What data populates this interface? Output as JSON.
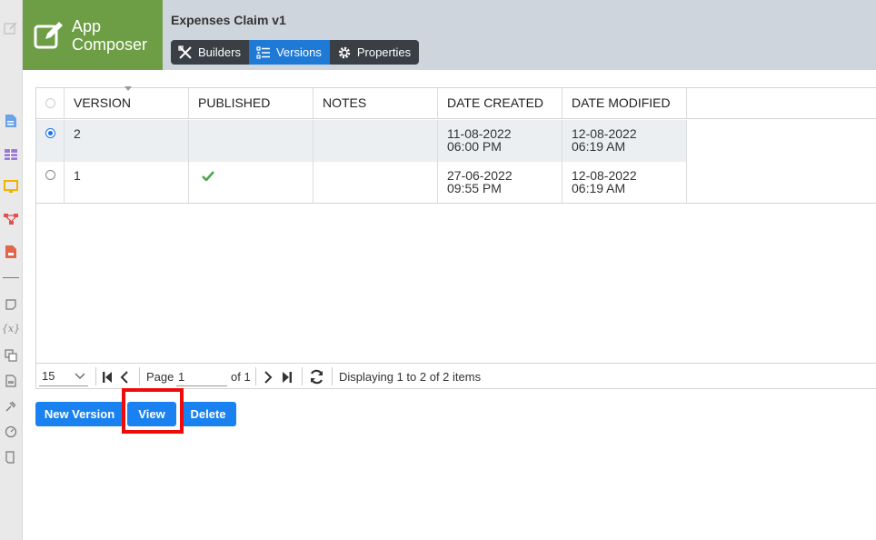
{
  "app": {
    "logo_line1": "App",
    "logo_line2": "Composer",
    "title": "Expenses Claim v1"
  },
  "tabs": [
    {
      "label": "Builders",
      "icon": "builders-icon",
      "active": false
    },
    {
      "label": "Versions",
      "icon": "list-icon",
      "active": true
    },
    {
      "label": "Properties",
      "icon": "gear-icon",
      "active": false
    }
  ],
  "rail_icons": [
    "edit-icon",
    "form-icon",
    "datalist-icon",
    "userview-icon",
    "process-icon",
    "report-icon",
    "note-icon",
    "variable-icon",
    "translate-icon",
    "file-icon",
    "plugin-icon",
    "dashboard-icon",
    "doc-icon"
  ],
  "grid": {
    "columns": [
      "VERSION",
      "PUBLISHED",
      "NOTES",
      "DATE CREATED",
      "DATE MODIFIED"
    ],
    "rows": [
      {
        "selected": true,
        "version": "2",
        "published": false,
        "notes": "",
        "date_created": "11-08-2022 06:00 PM",
        "date_modified": "12-08-2022 06:19 AM"
      },
      {
        "selected": false,
        "version": "1",
        "published": true,
        "notes": "",
        "date_created": "27-06-2022 09:55 PM",
        "date_modified": "12-08-2022 06:19 AM"
      }
    ]
  },
  "pager": {
    "page_size": "15",
    "page_label": "Page",
    "page_value": "1",
    "of_label": "of 1",
    "status": "Displaying 1 to 2 of 2 items"
  },
  "actions": {
    "new_version": "New Version",
    "view": "View",
    "delete": "Delete"
  },
  "colors": {
    "accent": "#1a82f0",
    "logo_bg": "#6d9e45",
    "header_bg": "#cfd5dc",
    "highlight": "#f00b0b"
  }
}
